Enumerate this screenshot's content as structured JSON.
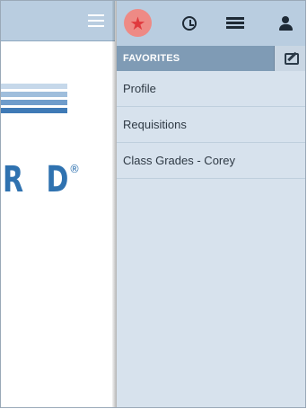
{
  "background_app": {
    "logo_text": "R D",
    "logo_mark": "®",
    "menu_icon": "hamburger-icon",
    "stripe_colors": [
      "#a6c3e0",
      "#7ea7d0",
      "#4f86bf",
      "#2f72b0"
    ]
  },
  "panel": {
    "tabs": [
      {
        "name": "favorites",
        "icon": "star-icon",
        "active": true
      },
      {
        "name": "history",
        "icon": "clock-icon",
        "active": false
      },
      {
        "name": "list",
        "icon": "list-icon",
        "active": false
      },
      {
        "name": "account",
        "icon": "person-icon",
        "active": false
      }
    ],
    "section_title": "FAVORITES",
    "edit_icon": "edit-icon",
    "items": [
      {
        "label": "Profile"
      },
      {
        "label": "Requisitions"
      },
      {
        "label": "Class Grades - Corey"
      }
    ]
  },
  "colors": {
    "topbar": "#b9cde0",
    "subbar": "#7f9bb5",
    "panel_bg": "#d7e2ed",
    "active_tab": "#ee8a85",
    "star": "#e03a3e",
    "logo_blue": "#2f72b0"
  }
}
